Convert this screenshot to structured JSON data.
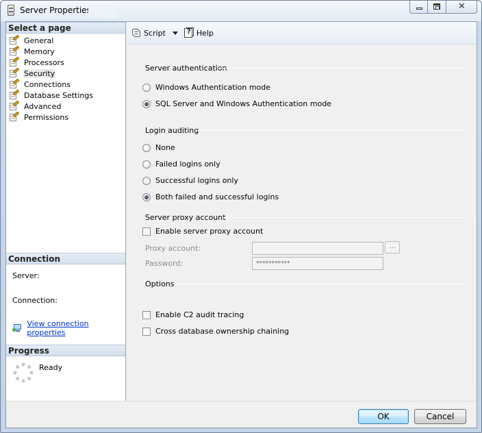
{
  "window": {
    "title": "Server Properties -"
  },
  "left": {
    "select_page_header": "Select a page",
    "pages": [
      {
        "label": "General"
      },
      {
        "label": "Memory"
      },
      {
        "label": "Processors"
      },
      {
        "label": "Security"
      },
      {
        "label": "Connections"
      },
      {
        "label": "Database Settings"
      },
      {
        "label": "Advanced"
      },
      {
        "label": "Permissions"
      }
    ],
    "connection_header": "Connection",
    "server_label": "Server:",
    "connection_label": "Connection:",
    "view_connection_link": "View connection properties",
    "progress_header": "Progress",
    "progress_status": "Ready"
  },
  "toolbar": {
    "script_label": "Script",
    "help_label": "Help"
  },
  "server_auth": {
    "title": "Server authentication",
    "options": [
      {
        "label": "Windows Authentication mode",
        "checked": false
      },
      {
        "label": "SQL Server and Windows Authentication mode",
        "checked": true
      }
    ]
  },
  "login_audit": {
    "title": "Login auditing",
    "options": [
      {
        "label": "None",
        "checked": false
      },
      {
        "label": "Failed logins only",
        "checked": false
      },
      {
        "label": "Successful logins only",
        "checked": false
      },
      {
        "label": "Both failed and successful logins",
        "checked": true
      }
    ]
  },
  "proxy": {
    "title": "Server proxy account",
    "enable_label": "Enable server proxy account",
    "proxy_account_label": "Proxy account:",
    "proxy_account_value": "",
    "password_label": "Password:",
    "password_value": "***********",
    "browse_label": "..."
  },
  "options": {
    "title": "Options",
    "c2_label": "Enable C2 audit tracing",
    "cross_db_label": "Cross database ownership chaining"
  },
  "buttons": {
    "ok": "OK",
    "cancel": "Cancel"
  }
}
